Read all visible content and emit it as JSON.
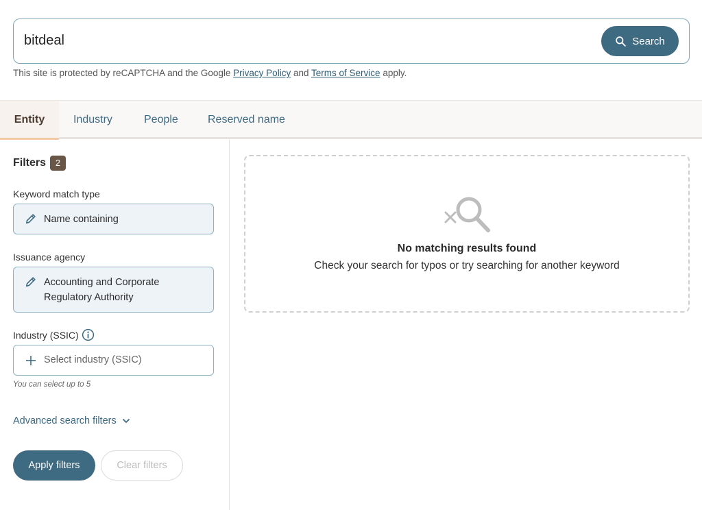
{
  "search": {
    "value": "bitdeal",
    "button_label": "Search",
    "recaptcha_prefix": "This site is protected by reCAPTCHA and the Google",
    "privacy_link": "Privacy Policy",
    "and_text": "and",
    "terms_link": "Terms of Service",
    "suffix": "apply."
  },
  "tabs": [
    {
      "label": "Entity",
      "active": true
    },
    {
      "label": "Industry",
      "active": false
    },
    {
      "label": "People",
      "active": false
    },
    {
      "label": "Reserved name",
      "active": false
    }
  ],
  "filters": {
    "title": "Filters",
    "count": "2",
    "keyword_label": "Keyword match type",
    "keyword_value": "Name containing",
    "agency_label": "Issuance agency",
    "agency_value": "Accounting and Corporate Regulatory Authority",
    "industry_label": "Industry (SSIC)",
    "industry_placeholder": "Select industry (SSIC)",
    "industry_helper": "You can select up to 5",
    "advanced_label": "Advanced search filters",
    "apply_label": "Apply filters",
    "clear_label": "Clear filters"
  },
  "results": {
    "title": "No matching results found",
    "message": "Check your search for typos or try searching for another keyword"
  },
  "icons": {
    "search": "search-icon",
    "pencil": "pencil-icon",
    "info": "info-icon",
    "plus": "plus-icon",
    "chevron": "chevron-down-icon",
    "no_results": "no-results-magnifier-icon"
  },
  "colors": {
    "primary": "#3f6b82",
    "link": "#3b6a84",
    "badge": "#6a5647",
    "active_tab_underline": "#f1c9a5"
  }
}
